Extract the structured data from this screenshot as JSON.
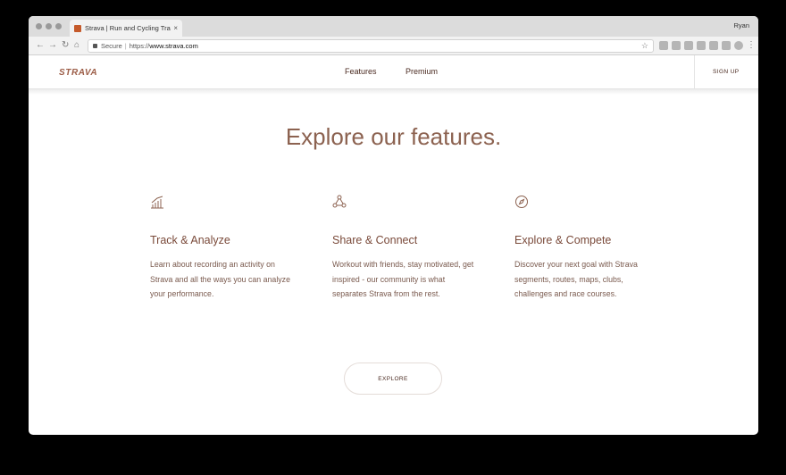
{
  "browser": {
    "tab_title": "Strava | Run and Cycling Track",
    "tab_close": "×",
    "profile_name": "Ryan",
    "secure_label": "Secure",
    "url_scheme": "https://",
    "url_domain": "www.strava.com",
    "back_icon": "←",
    "forward_icon": "→",
    "reload_icon": "↻",
    "home_icon": "⌂",
    "star_icon": "☆"
  },
  "site": {
    "logo": "STRAVA",
    "nav": [
      {
        "label": "Features"
      },
      {
        "label": "Premium"
      }
    ],
    "signup_label": "SIGN UP"
  },
  "main": {
    "headline": "Explore our features.",
    "features": [
      {
        "icon": "bar-chart-icon",
        "title": "Track & Analyze",
        "body": "Learn about recording an activity on Strava and all the ways you can analyze your performance."
      },
      {
        "icon": "share-network-icon",
        "title": "Share & Connect",
        "body": "Workout with friends, stay motivated, get inspired - our community is what separates Strava from the rest."
      },
      {
        "icon": "compass-icon",
        "title": "Explore & Compete",
        "body": "Discover your next goal with Strava segments, routes, maps, clubs, challenges and race courses."
      }
    ],
    "explore_button": "EXPLORE"
  },
  "colors": {
    "brand": "#9c5d47",
    "heading": "#8c6250",
    "text": "#7a5a4e"
  }
}
